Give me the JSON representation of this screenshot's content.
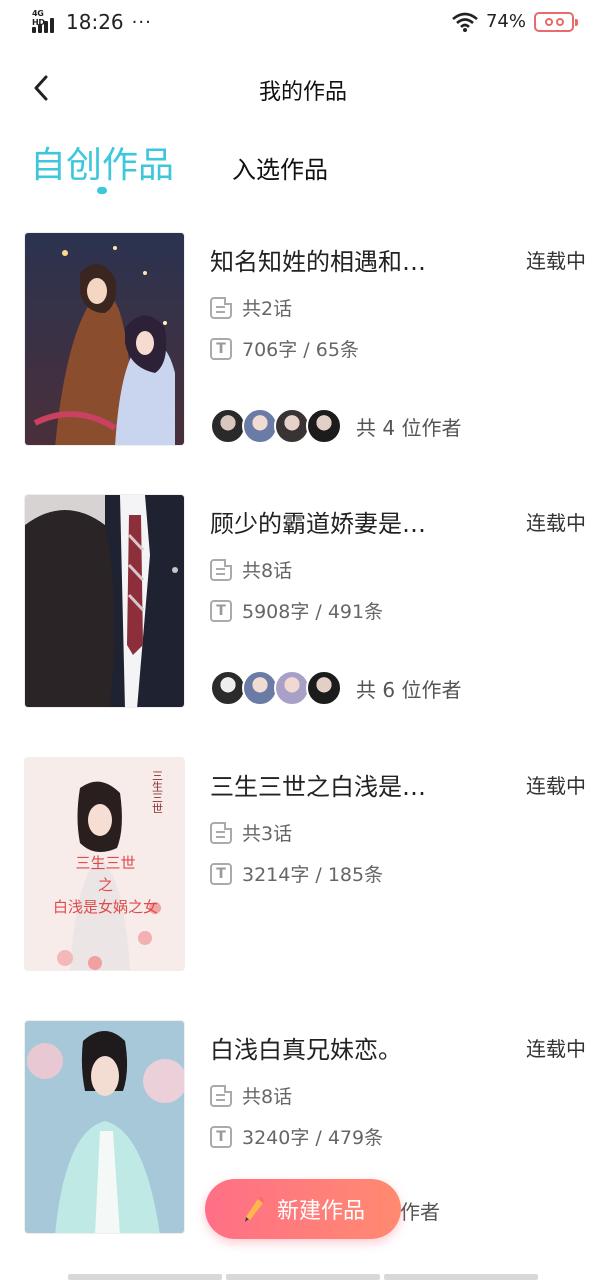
{
  "status_bar": {
    "network": "4G HD",
    "time": "18:26",
    "more": "···",
    "battery_percent": "74%",
    "battery_color": "#e86a6a"
  },
  "header": {
    "back_icon": "chevron-left-icon",
    "title": "我的作品"
  },
  "tabs": [
    {
      "label": "自创作品",
      "active": true
    },
    {
      "label": "入选作品",
      "active": false
    }
  ],
  "accent_color": "#3ec7dc",
  "works": [
    {
      "title": "知名知姓的相遇和…",
      "status": "连载中",
      "chapters": "共2话",
      "stats": "706字 / 65条",
      "authors_count": "共 4 位作者",
      "avatar_count": 4
    },
    {
      "title": "顾少的霸道娇妻是…",
      "status": "连载中",
      "chapters": "共8话",
      "stats": "5908字 / 491条",
      "authors_count": "共 6 位作者",
      "avatar_count": 4
    },
    {
      "title": "三生三世之白浅是…",
      "status": "连载中",
      "chapters": "共3话",
      "stats": "3214字 / 185条",
      "cover_text": [
        "三生三世",
        "之",
        "白浅是女娲之女"
      ]
    },
    {
      "title": "白浅白真兄妹恋。",
      "status": "连载中",
      "chapters": "共8话",
      "stats": "3240字 / 479条",
      "authors_partial": "作者"
    }
  ],
  "fab": {
    "label": "新建作品",
    "icon": "pencil-icon"
  }
}
